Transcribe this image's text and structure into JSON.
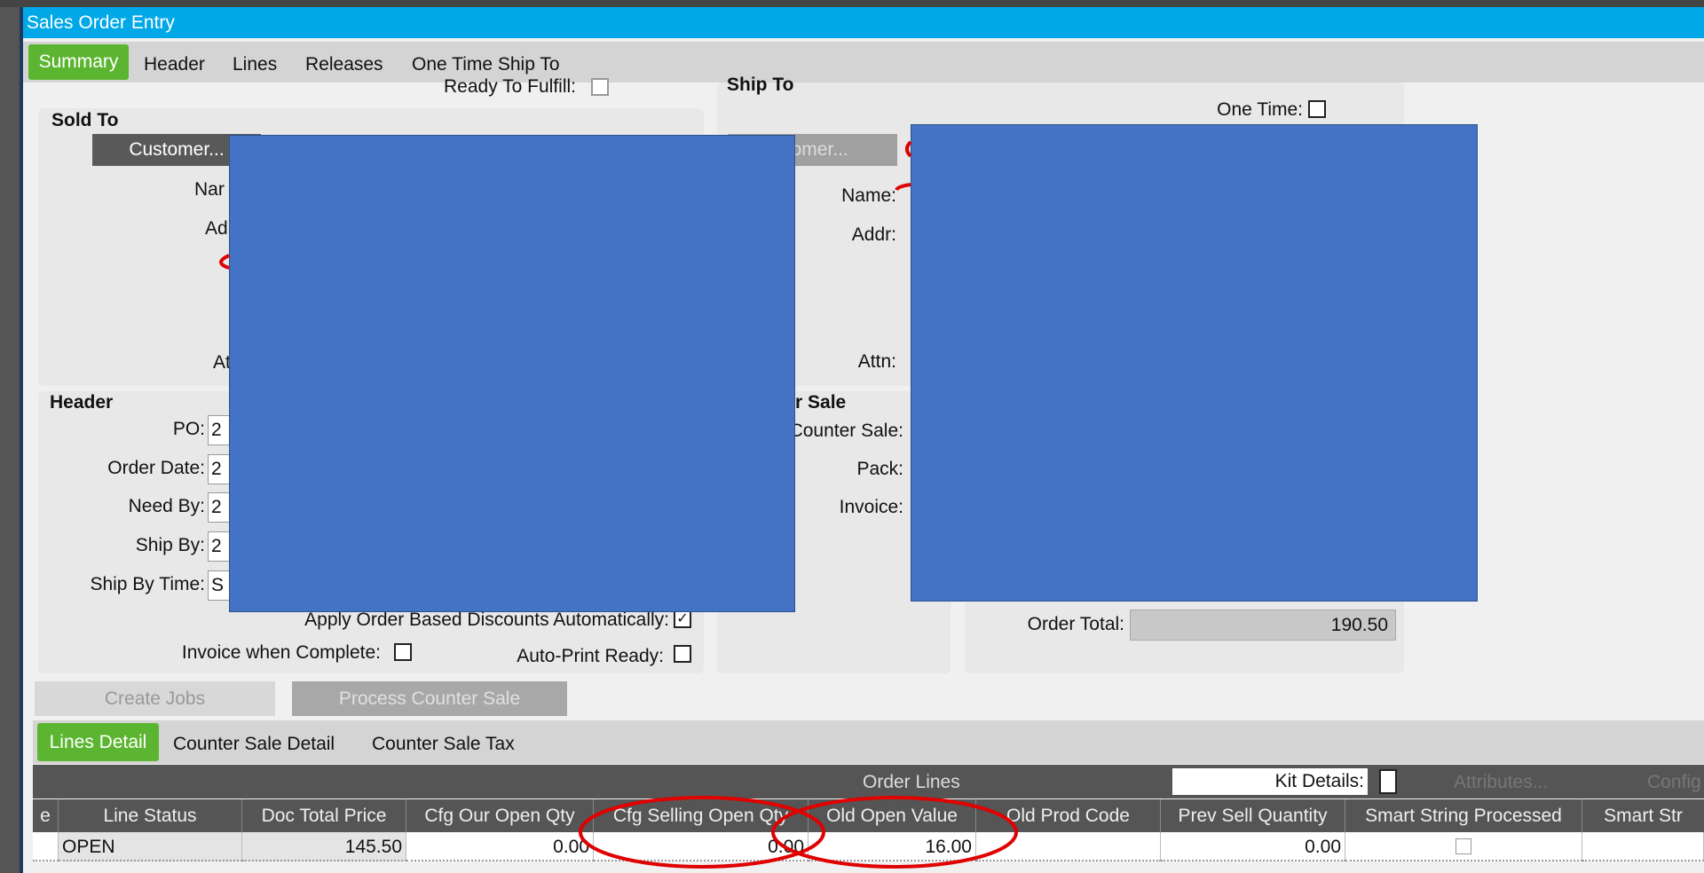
{
  "window": {
    "title": "Sales Order Entry"
  },
  "tabs": [
    {
      "label": "Summary"
    },
    {
      "label": "Header"
    },
    {
      "label": "Lines"
    },
    {
      "label": "Releases"
    },
    {
      "label": "One Time Ship To"
    }
  ],
  "summary": {
    "ready_to_fulfill_label": "Ready To Fulfill:",
    "sold_to": {
      "title": "Sold To",
      "customer_button": "Customer...",
      "name_label": "Nar",
      "addr_label": "Ad",
      "attn_label": "At"
    },
    "ship_to": {
      "title": "Ship To",
      "one_time_label": "One Time:",
      "customer_button": "stomer...",
      "name_label": "Name:",
      "addr_label": "Addr:",
      "attn_label": "Attn:"
    },
    "header": {
      "title": "Header",
      "po_label": "PO:",
      "po_value": "2",
      "order_date_label": "Order Date:",
      "order_date_value": "2",
      "need_by_label": "Need By:",
      "need_by_value": "2",
      "ship_by_label": "Ship By:",
      "ship_by_value": "2",
      "ship_by_time_label": "Ship By Time:",
      "ship_by_time_value": "S",
      "apply_discounts_label": "Apply Order Based Discounts Automatically:",
      "apply_discounts_checked": true,
      "invoice_when_complete_label": "Invoice when Complete:",
      "auto_print_label": "Auto-Print Ready:"
    },
    "counter_sale": {
      "title": "r Sale",
      "counter_sale_label": "Counter Sale:",
      "pack_label": "Pack:",
      "invoice_label": "Invoice:"
    },
    "order_total_label": "Order Total:",
    "order_total_value": "190.50",
    "create_jobs_button": "Create Jobs",
    "process_counter_sale_button": "Process Counter Sale"
  },
  "lower_tabs": [
    {
      "label": "Lines Detail"
    },
    {
      "label": "Counter Sale Detail"
    },
    {
      "label": "Counter Sale Tax"
    }
  ],
  "order_lines": {
    "title": "Order Lines",
    "kit_details_label": "Kit Details:",
    "attributes_button": "Attributes...",
    "config_button": "Config",
    "columns": [
      "e",
      "Line Status",
      "Doc Total Price",
      "Cfg Our Open Qty",
      "Cfg Selling Open Qty",
      "Old Open Value",
      "Old Prod Code",
      "Prev Sell Quantity",
      "Smart String Processed",
      "Smart Str"
    ],
    "rows": [
      {
        "line_status": "OPEN",
        "doc_total_price": "145.50",
        "cfg_our_open_qty": "0.00",
        "cfg_selling_open_qty": "0.00",
        "old_open_value": "16.00",
        "old_prod_code": "",
        "prev_sell_quantity": "0.00",
        "smart_string_processed": false
      }
    ]
  },
  "colors": {
    "title_bar": "#00a8e8",
    "active_tab": "#5cb531",
    "redaction": "#4472c4",
    "annotation": "#e00000"
  }
}
